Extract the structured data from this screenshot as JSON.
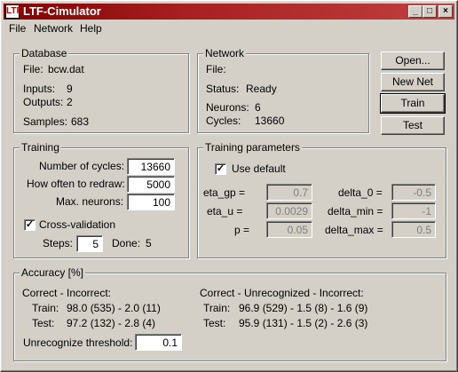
{
  "window": {
    "title": "LTF-Cimulator",
    "app_icon_label": "LTF",
    "min_glyph": "_",
    "max_glyph": "□",
    "close_glyph": "×"
  },
  "menu": {
    "file": "File",
    "network": "Network",
    "help": "Help"
  },
  "database": {
    "legend": "Database",
    "file_label": "File:",
    "file_value": "bcw.dat",
    "inputs_label": "Inputs:",
    "inputs_value": "9",
    "outputs_label": "Outputs:",
    "outputs_value": "2",
    "samples_label": "Samples:",
    "samples_value": "683"
  },
  "network": {
    "legend": "Network",
    "file_label": "File:",
    "file_value": "",
    "status_label": "Status:",
    "status_value": "Ready",
    "neurons_label": "Neurons:",
    "neurons_value": "6",
    "cycles_label": "Cycles:",
    "cycles_value": "13660"
  },
  "buttons": {
    "open": "Open...",
    "new_net": "New Net",
    "train": "Train",
    "test": "Test"
  },
  "training": {
    "legend": "Training",
    "cycles_label": "Number of cycles:",
    "cycles_value": "13660",
    "redraw_label": "How often to redraw:",
    "redraw_value": "5000",
    "max_neurons_label": "Max. neurons:",
    "max_neurons_value": "100",
    "cross_validation_label": "Cross-validation",
    "cross_validation_checked": true,
    "steps_label": "Steps:",
    "steps_value": "5",
    "done_label": "Done:",
    "done_value": "5"
  },
  "params": {
    "legend": "Training parameters",
    "use_default_label": "Use default",
    "use_default_checked": true,
    "eta_gp_label": "eta_gp =",
    "eta_gp_value": "0.7",
    "eta_u_label": "eta_u =",
    "eta_u_value": "0.0029",
    "p_label": "p =",
    "p_value": "0.05",
    "delta_0_label": "delta_0 =",
    "delta_0_value": "-0.5",
    "delta_min_label": "delta_min =",
    "delta_min_value": "-1",
    "delta_max_label": "delta_max =",
    "delta_max_value": "0.5"
  },
  "accuracy": {
    "legend": "Accuracy [%]",
    "left_header": "Correct - Incorrect:",
    "train_label": "Train:",
    "left_train": "98.0 (535) - 2.0 (11)",
    "test_label": "Test:",
    "left_test": "97.2 (132) - 2.8 (4)",
    "right_header": "Correct - Unrecognized - Incorrect:",
    "right_train": "96.9 (529) - 1.5 (8) - 1.6 (9)",
    "right_test": "95.9 (131) - 1.5 (2) - 2.6 (3)",
    "threshold_label": "Unrecognize threshold:",
    "threshold_value": "0.1"
  }
}
